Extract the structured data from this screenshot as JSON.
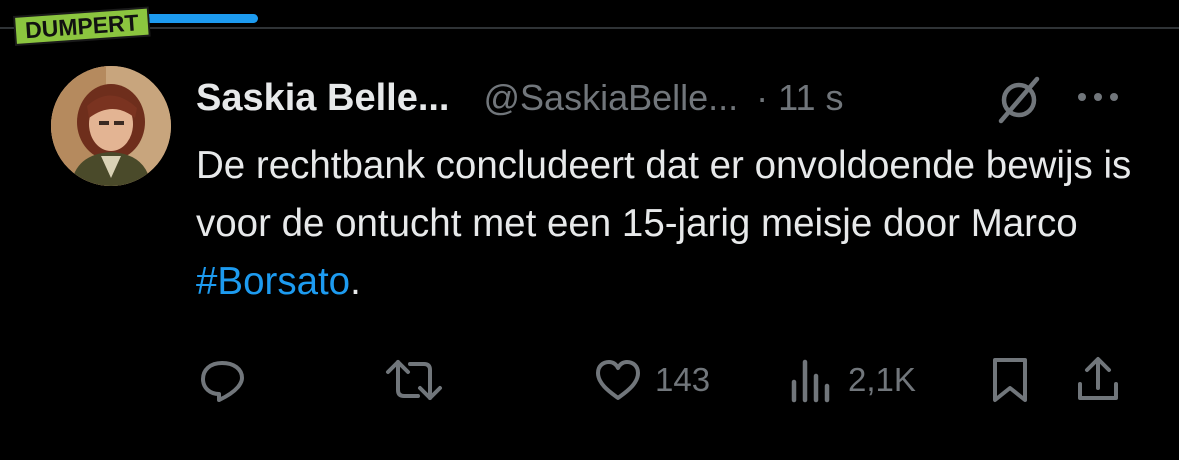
{
  "watermark": {
    "brand": "DUMPERT",
    "progress": 0.22
  },
  "tweet": {
    "author_name": "Saskia Belle...",
    "author_handle": "@SaskiaBelle...",
    "timestamp": "· 11 s",
    "text_before": "De rechtbank concludeert dat er onvoldoende bewijs is voor de ontucht met een 15-jarig meisje door Marco ",
    "hashtag": "#Borsato",
    "text_after": "."
  },
  "actions": {
    "replies": "",
    "retweets": "",
    "likes": "143",
    "views": "2,1K"
  },
  "icons": [
    "circle-slash-icon",
    "more-icon",
    "reply-icon",
    "retweet-icon",
    "heart-icon",
    "views-icon",
    "bookmark-icon",
    "share-icon"
  ],
  "colors": {
    "background": "#000000",
    "text": "#e7e9ea",
    "muted": "#71767b",
    "accent": "#1d9bf0",
    "logo": "#8bc53f"
  }
}
